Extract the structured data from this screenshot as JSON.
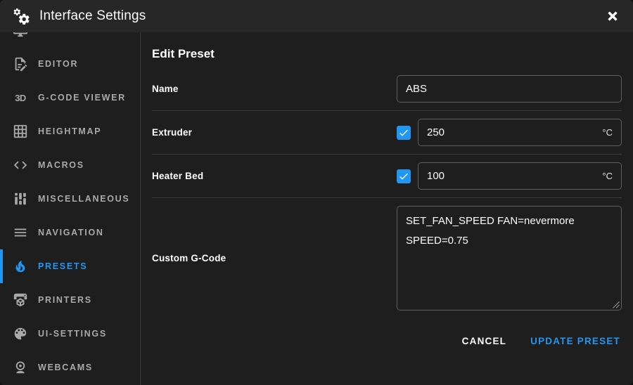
{
  "header": {
    "title": "Interface Settings",
    "app_icon": "cogs-icon",
    "close_icon": "close-icon"
  },
  "sidebar": {
    "items": [
      {
        "label": "",
        "icon": "monitor-icon",
        "note": "partially scrolled out of view",
        "active": false
      },
      {
        "label": "EDITOR",
        "icon": "file-edit-icon",
        "active": false
      },
      {
        "label": "G-CODE VIEWER",
        "icon": "3d-icon",
        "icon_text": "3D",
        "active": false
      },
      {
        "label": "HEIGHTMAP",
        "icon": "grid-icon",
        "active": false
      },
      {
        "label": "MACROS",
        "icon": "code-tags-icon",
        "active": false
      },
      {
        "label": "MISCELLANEOUS",
        "icon": "sliders-icon",
        "active": false
      },
      {
        "label": "NAVIGATION",
        "icon": "menu-icon",
        "active": false
      },
      {
        "label": "PRESETS",
        "icon": "fire-icon",
        "active": true
      },
      {
        "label": "PRINTERS",
        "icon": "printer-3d-icon",
        "active": false
      },
      {
        "label": "UI-SETTINGS",
        "icon": "palette-icon",
        "active": false
      },
      {
        "label": "WEBCAMS",
        "icon": "webcam-icon",
        "active": false
      }
    ]
  },
  "form": {
    "title": "Edit Preset",
    "fields": {
      "name": {
        "label": "Name",
        "value": "ABS"
      },
      "extruder": {
        "label": "Extruder",
        "checked": true,
        "value": "250",
        "unit": "°C"
      },
      "heater_bed": {
        "label": "Heater Bed",
        "checked": true,
        "value": "100",
        "unit": "°C"
      },
      "custom_gcode": {
        "label": "Custom G-Code",
        "value": "SET_FAN_SPEED FAN=nevermore SPEED=0.75"
      }
    },
    "actions": {
      "cancel_label": "CANCEL",
      "submit_label": "UPDATE PRESET"
    }
  },
  "colors": {
    "accent": "#2196f3",
    "titlebar_bg": "#272727",
    "body_bg": "#1e1e1e",
    "divider": "#3a3a3a",
    "input_border": "#5f5f5f",
    "sidebar_text": "#a9a9a9"
  }
}
